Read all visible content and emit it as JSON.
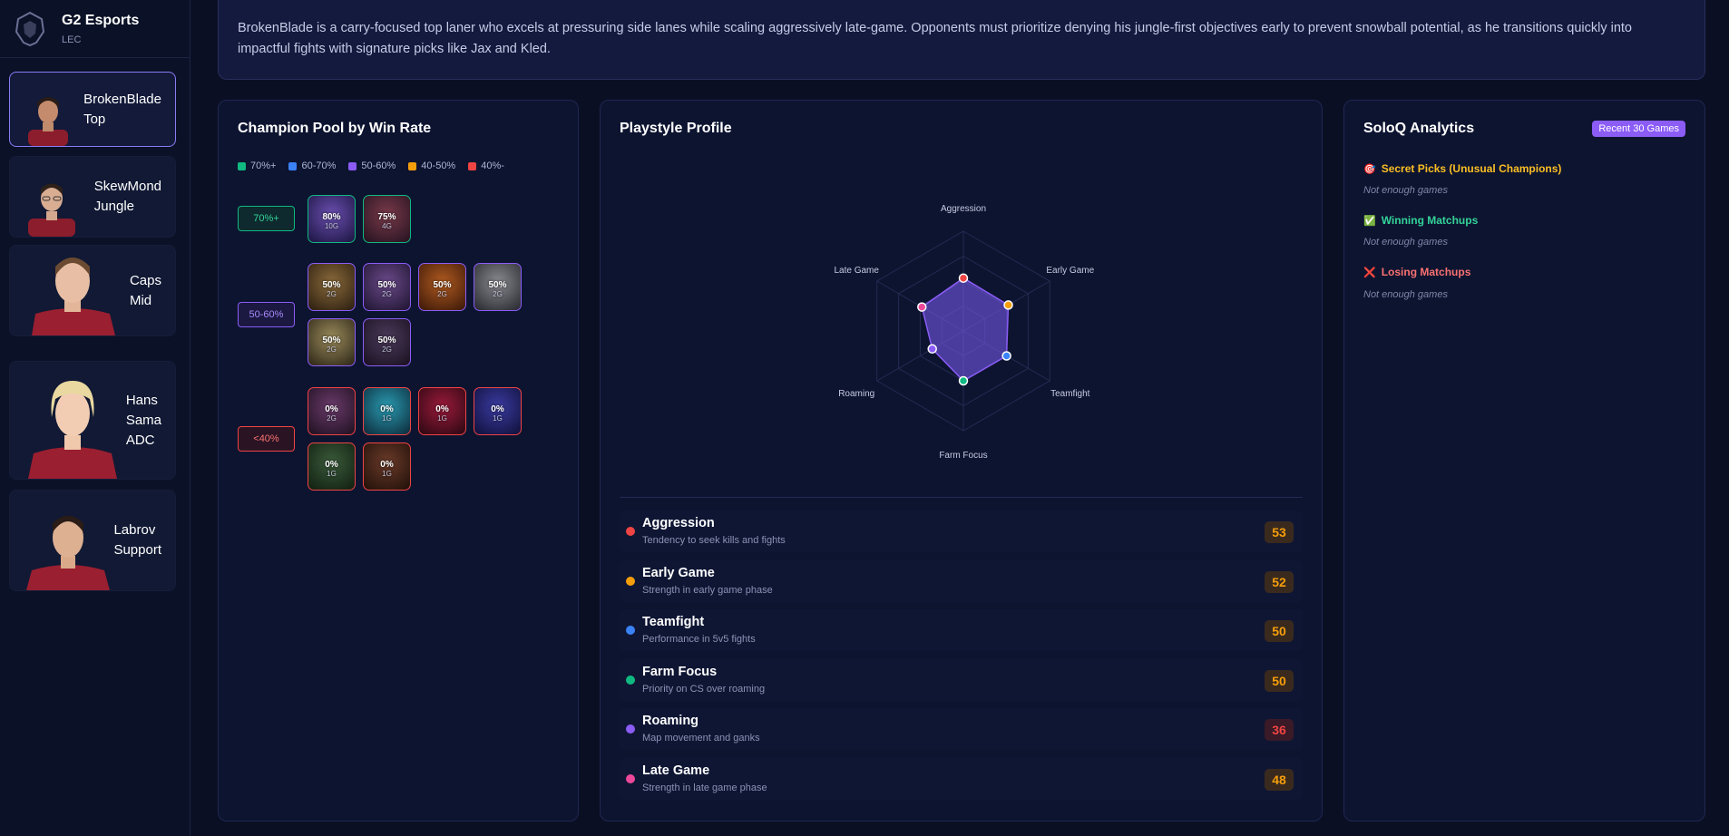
{
  "team": {
    "name": "G2 Esports",
    "league": "LEC"
  },
  "players": [
    {
      "name": "BrokenBlade",
      "role": "Top",
      "active": true
    },
    {
      "name": "SkewMond",
      "role": "Jungle",
      "active": false
    },
    {
      "name": "Caps",
      "role": "Mid",
      "active": false
    },
    {
      "name": "Hans Sama",
      "name_line1": "Hans",
      "name_line2": "Sama",
      "role": "ADC",
      "active": false
    },
    {
      "name": "Labrov",
      "role": "Support",
      "active": false
    }
  ],
  "description": "BrokenBlade is a carry-focused top laner who excels at pressuring side lanes while scaling aggressively late-game. Opponents must prioritize denying his jungle-first objectives early to prevent snowball potential, as he transitions quickly into impactful fights with signature picks like Jax and Kled.",
  "champion_pool": {
    "title": "Champion Pool by Win Rate",
    "legend": [
      {
        "label": "70%+",
        "color": "#10b981"
      },
      {
        "label": "60-70%",
        "color": "#3b82f6"
      },
      {
        "label": "50-60%",
        "color": "#8b5cf6"
      },
      {
        "label": "40-50%",
        "color": "#f59e0b"
      },
      {
        "label": "40%-",
        "color": "#ef4444"
      }
    ],
    "tiers": [
      {
        "label": "70%+",
        "color": "#10b981",
        "champions": [
          {
            "wr": "80%",
            "games": "10G"
          },
          {
            "wr": "75%",
            "games": "4G"
          }
        ]
      },
      {
        "label": "50-60%",
        "color": "#8b5cf6",
        "champions": [
          {
            "wr": "50%",
            "games": "2G"
          },
          {
            "wr": "50%",
            "games": "2G"
          },
          {
            "wr": "50%",
            "games": "2G"
          },
          {
            "wr": "50%",
            "games": "2G"
          },
          {
            "wr": "50%",
            "games": "2G"
          },
          {
            "wr": "50%",
            "games": "2G"
          }
        ]
      },
      {
        "label": "<40%",
        "color": "#ef4444",
        "champions": [
          {
            "wr": "0%",
            "games": "2G"
          },
          {
            "wr": "0%",
            "games": "1G"
          },
          {
            "wr": "0%",
            "games": "1G"
          },
          {
            "wr": "0%",
            "games": "1G"
          },
          {
            "wr": "0%",
            "games": "1G"
          },
          {
            "wr": "0%",
            "games": "1G"
          }
        ]
      }
    ]
  },
  "playstyle": {
    "title": "Playstyle Profile",
    "axes": [
      "Aggression",
      "Early Game",
      "Teamfight",
      "Farm Focus",
      "Roaming",
      "Late Game"
    ],
    "stats": [
      {
        "name": "Aggression",
        "desc": "Tendency to seek kills and fights",
        "value": 53,
        "color": "#ef4444"
      },
      {
        "name": "Early Game",
        "desc": "Strength in early game phase",
        "value": 52,
        "color": "#f59e0b"
      },
      {
        "name": "Teamfight",
        "desc": "Performance in 5v5 fights",
        "value": 50,
        "color": "#3b82f6"
      },
      {
        "name": "Farm Focus",
        "desc": "Priority on CS over roaming",
        "value": 50,
        "color": "#10b981"
      },
      {
        "name": "Roaming",
        "desc": "Map movement and ganks",
        "value": 36,
        "color": "#8b5cf6"
      },
      {
        "name": "Late Game",
        "desc": "Strength in late game phase",
        "value": 48,
        "color": "#ec4899"
      }
    ]
  },
  "soloq": {
    "title": "SoloQ Analytics",
    "badge": "Recent 30 Games",
    "sections": [
      {
        "icon": "🎯",
        "title": "Secret Picks (Unusual Champions)",
        "color": "#fbbf24",
        "note": "Not enough games"
      },
      {
        "icon": "✅",
        "title": "Winning Matchups",
        "color": "#34d399",
        "note": "Not enough games"
      },
      {
        "icon": "❌",
        "title": "Losing Matchups",
        "color": "#f87171",
        "note": "Not enough games"
      }
    ]
  }
}
